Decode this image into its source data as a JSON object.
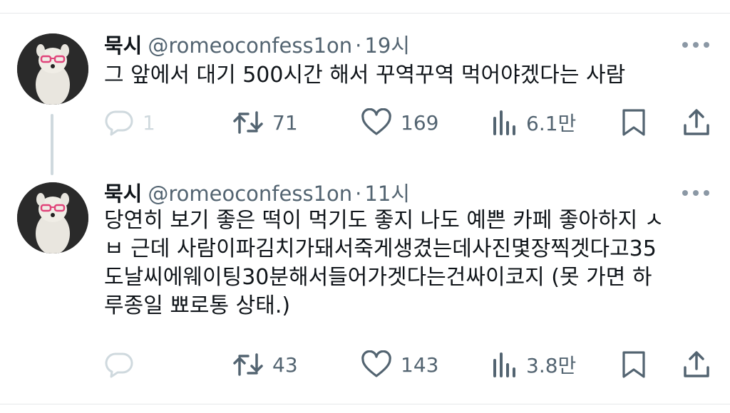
{
  "tweets": [
    {
      "name": "묵시",
      "handle": "@romeoconfess1on",
      "dot": "·",
      "time": "19시",
      "text": "그 앞에서 대기 500시간 해서 꾸역꾸역 먹어야겠다는 사람",
      "reply_count": "1",
      "retweet_count": "71",
      "like_count": "169",
      "view_count": "6.1만"
    },
    {
      "name": "묵시",
      "handle": "@romeoconfess1on",
      "dot": "·",
      "time": "11시",
      "text": "당연히 보기 좋은 떡이 먹기도 좋지 나도 예쁜 카페 좋아하지 ㅅ\nㅂ 근데 사람이파김치가돼서죽게생겼는데사진몇장찍겟다고35\n도날씨에웨이팅30분해서들어가겟다는건싸이코지 (못 가면 하\n루종일 뾰로통 상태.)",
      "reply_count": "",
      "retweet_count": "43",
      "like_count": "143",
      "view_count": "3.8만"
    }
  ],
  "icons": {
    "reply": "speech-bubble-icon",
    "retweet": "retweet-arrows-icon",
    "like": "heart-outline-icon",
    "views": "bar-chart-icon",
    "bookmark": "bookmark-icon",
    "share": "share-upload-icon",
    "more": "more-dots-icon"
  },
  "colors": {
    "text": "#0f1419",
    "secondary": "#536471",
    "faded_reply": "#cfd9de",
    "divider": "#e6e8ea"
  }
}
